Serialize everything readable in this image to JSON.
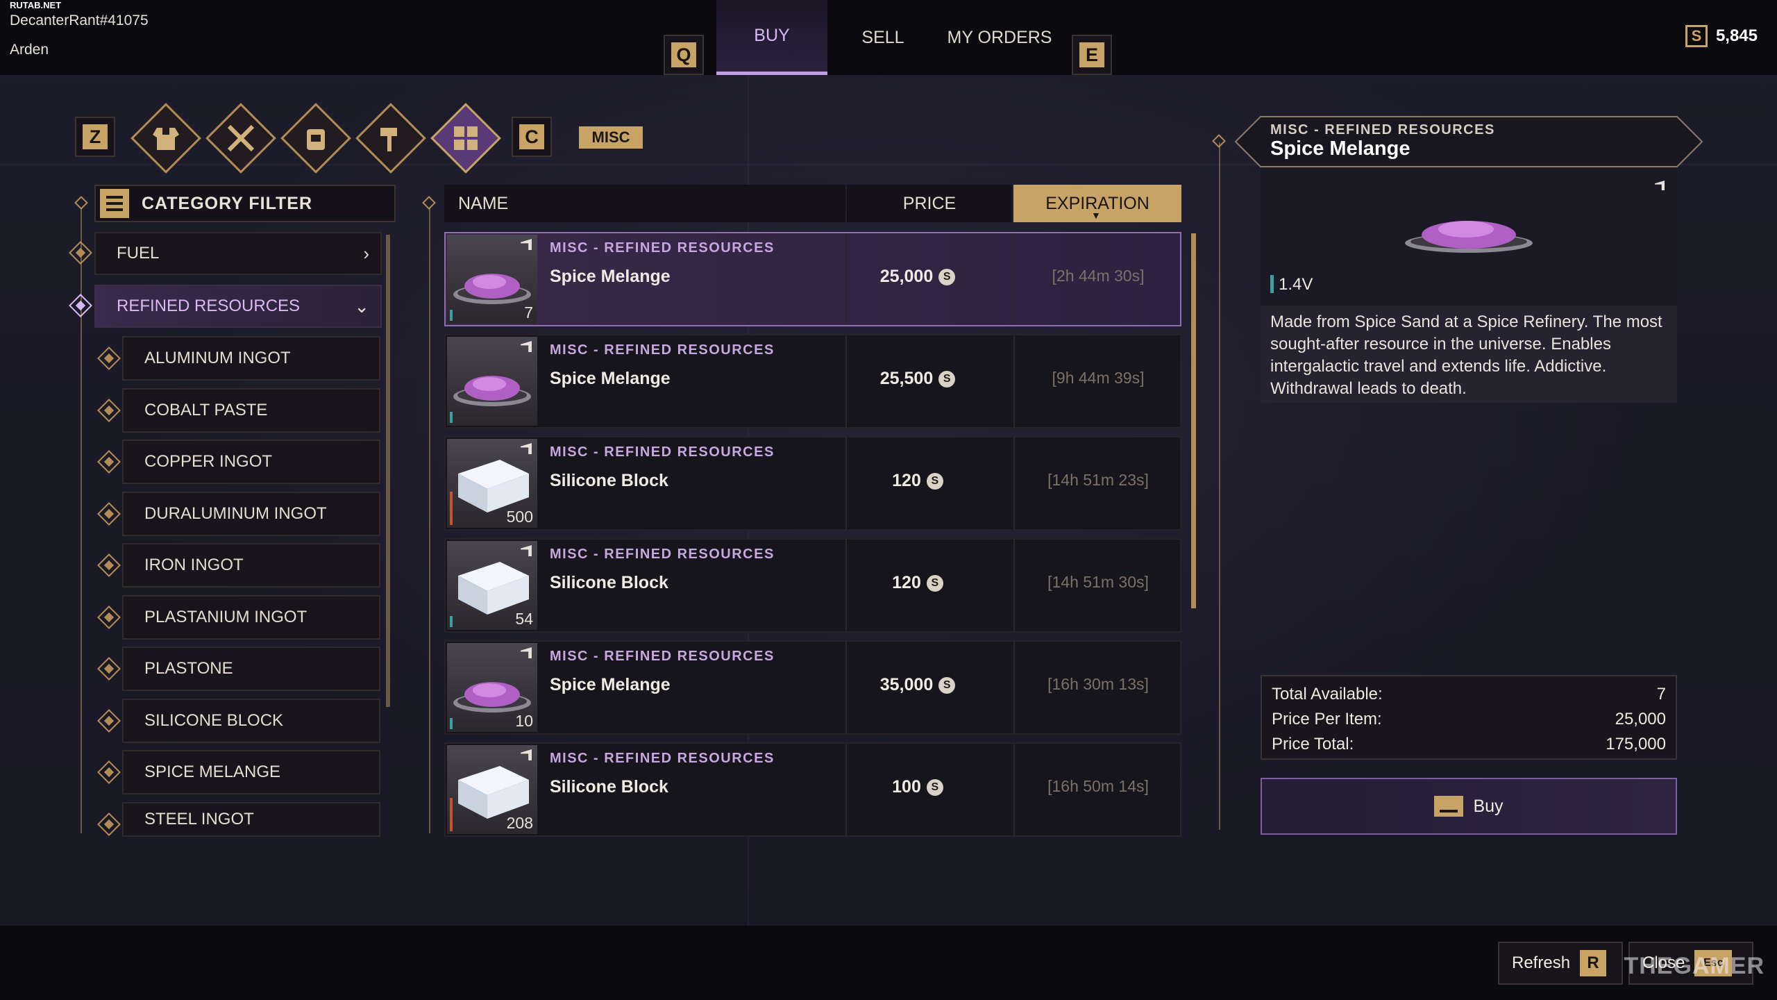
{
  "header": {
    "site": "RUTAB.NET",
    "username": "DecanterRant#41075",
    "location": "Arden",
    "key_prev": "Q",
    "key_next": "E",
    "tabs": [
      {
        "label": "BUY",
        "active": true
      },
      {
        "label": "SELL",
        "active": false
      },
      {
        "label": "MY ORDERS",
        "active": false
      }
    ],
    "currency_icon": "S",
    "balance": "5,845"
  },
  "category_bar": {
    "key_left": "Z",
    "key_right": "C",
    "icons": [
      "armor-icon",
      "weapons-icon",
      "backpack-icon",
      "tools-icon",
      "misc-grid-icon"
    ],
    "selected_label": "MISC"
  },
  "filter": {
    "title": "CATEGORY FILTER",
    "parents": [
      {
        "label": "FUEL",
        "chevron": "›"
      },
      {
        "label": "REFINED RESOURCES",
        "chevron": "⌄"
      }
    ],
    "children": [
      "ALUMINUM INGOT",
      "COBALT PASTE",
      "COPPER INGOT",
      "DURALUMINUM INGOT",
      "IRON INGOT",
      "PLASTANIUM INGOT",
      "PLASTONE",
      "SILICONE BLOCK",
      "SPICE MELANGE",
      "STEEL INGOT"
    ]
  },
  "listing": {
    "columns": {
      "name": "NAME",
      "price": "PRICE",
      "expiration": "EXPIRATION"
    },
    "rows": [
      {
        "category": "MISC - REFINED RESOURCES",
        "name": "Spice Melange",
        "price": "25,000",
        "expiration": "[2h 44m 30s]",
        "qty": "7",
        "item": "spice",
        "selected": true
      },
      {
        "category": "MISC - REFINED RESOURCES",
        "name": "Spice Melange",
        "price": "25,500",
        "expiration": "[9h 44m 39s]",
        "qty": "",
        "item": "spice",
        "selected": false
      },
      {
        "category": "MISC - REFINED RESOURCES",
        "name": "Silicone Block",
        "price": "120",
        "expiration": "[14h 51m 23s]",
        "qty": "500",
        "item": "silicone",
        "selected": false
      },
      {
        "category": "MISC - REFINED RESOURCES",
        "name": "Silicone Block",
        "price": "120",
        "expiration": "[14h 51m 30s]",
        "qty": "54",
        "item": "silicone",
        "selected": false
      },
      {
        "category": "MISC - REFINED RESOURCES",
        "name": "Spice Melange",
        "price": "35,000",
        "expiration": "[16h 30m 13s]",
        "qty": "10",
        "item": "spice",
        "selected": false
      },
      {
        "category": "MISC - REFINED RESOURCES",
        "name": "Silicone Block",
        "price": "100",
        "expiration": "[16h 50m 14s]",
        "qty": "208",
        "item": "silicone",
        "selected": false
      }
    ]
  },
  "detail": {
    "category": "MISC - REFINED RESOURCES",
    "name": "Spice Melange",
    "volume": "1.4V",
    "description": "Made from Spice Sand at a Spice Refinery. The most sought-after resource in the universe. Enables intergalactic travel and extends life. Addictive. Withdrawal leads to death.",
    "total_available_label": "Total Available:",
    "total_available": "7",
    "price_per_item_label": "Price Per Item:",
    "price_per_item": "25,000",
    "price_total_label": "Price Total:",
    "price_total": "175,000",
    "buy_label": "Buy"
  },
  "footer": {
    "refresh_label": "Refresh",
    "refresh_key": "R",
    "close_label": "Close",
    "close_key": "Esc",
    "watermark": "THEGAMER"
  },
  "colors": {
    "accent_gold": "#c7a366",
    "accent_purple": "#c19ee0",
    "selected_row": "#3b2848"
  }
}
